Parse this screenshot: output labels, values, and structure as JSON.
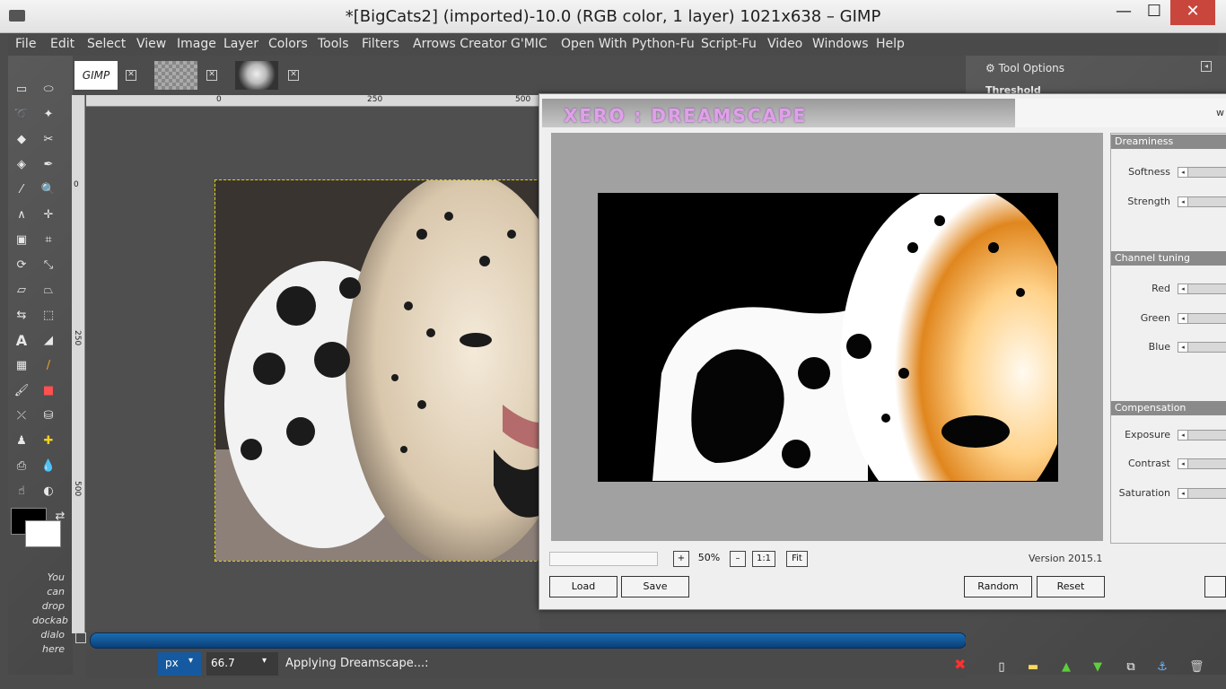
{
  "window": {
    "title": "*[BigCats2] (imported)-10.0 (RGB color, 1 layer) 1021x638 – GIMP",
    "minimize": "—",
    "maximize": "☐",
    "close": "✕"
  },
  "menu": [
    "File",
    "Edit",
    "Select",
    "View",
    "Image",
    "Layer",
    "Colors",
    "Tools",
    "Filters",
    "Arrows Creator",
    "G'MIC",
    "Open With",
    "Python-Fu",
    "Script-Fu",
    "Video",
    "Windows",
    "Help"
  ],
  "image_tabs": [
    {
      "label": "GIMP",
      "close": "✕"
    },
    {
      "label": "",
      "close": "✕"
    },
    {
      "label": "",
      "close": "✕"
    }
  ],
  "toolbox": {
    "hint_lines": [
      "You",
      "can",
      "drop",
      "dockab",
      "dialo",
      "here"
    ]
  },
  "ruler": {
    "top_ticks": [
      "0",
      "250",
      "500"
    ],
    "left_ticks": [
      "0",
      "250",
      "500"
    ]
  },
  "statusbar": {
    "unit": "px",
    "zoom": "66.7",
    "message": "Applying Dreamscape...:"
  },
  "right_dock": {
    "tool_options": "Tool Options",
    "threshold": "Threshold"
  },
  "plugin": {
    "title": "XERO : DREAMSCAPE",
    "title_suffix": "w",
    "groups": [
      {
        "name": "Dreaminess",
        "params": [
          "Softness",
          "Strength"
        ]
      },
      {
        "name": "Channel tuning",
        "params": [
          "Red",
          "Green",
          "Blue"
        ]
      },
      {
        "name": "Compensation",
        "params": [
          "Exposure",
          "Contrast",
          "Saturation"
        ]
      }
    ],
    "zoom_plus": "+",
    "zoom_value": "50%",
    "zoom_minus": "–",
    "zoom_1to1": "1:1",
    "zoom_fit": "Fit",
    "version": "Version 2015.1",
    "buttons": {
      "load": "Load",
      "save": "Save",
      "random": "Random",
      "reset": "Reset"
    }
  },
  "colors": {
    "accent": "#155aa0",
    "close_btn": "#c9463d",
    "selection": "#e4d400"
  }
}
